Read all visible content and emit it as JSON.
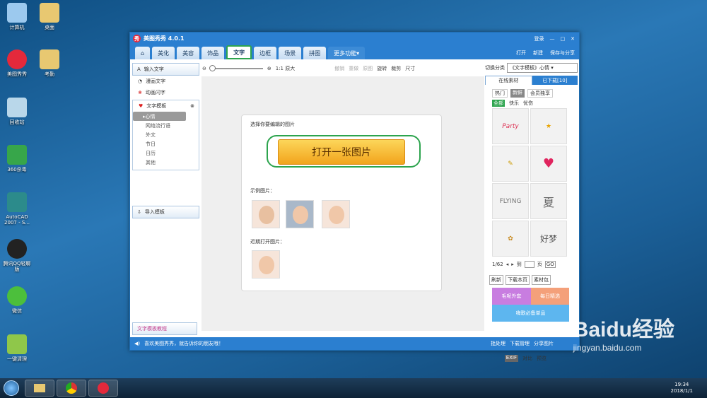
{
  "desktop_icons": [
    "计算机",
    "桌面",
    "美图秀秀",
    "考勤",
    "回收站",
    "360杀毒",
    "AutoCAD 2007 - S...",
    "腾讯QQ轻聊版",
    "微信",
    "一键清理"
  ],
  "window": {
    "title": "美图秀秀 4.0.1",
    "login": "登录"
  },
  "tabs": [
    "美化",
    "美容",
    "饰品",
    "文字",
    "边框",
    "场景",
    "拼图",
    "更多功能"
  ],
  "tab_actions": [
    "打开",
    "新建",
    "保存与分享"
  ],
  "left": {
    "input_text": "输入文字",
    "comic_text": "漫画文字",
    "animated_text": "动画闪字",
    "template_title": "文字模板",
    "subs": [
      "心情",
      "网络流行语",
      "外文",
      "节日",
      "日历",
      "其他"
    ],
    "import": "导入模板",
    "tutorial": "文字模板教程"
  },
  "toolbar": {
    "original": "1:1 原大",
    "undo": "撤销",
    "redo": "重做",
    "original_img": "原图",
    "rotate": "旋转",
    "crop": "裁剪",
    "size": "尺寸"
  },
  "card": {
    "choose": "选择你要编辑的图片",
    "open": "打开一张图片",
    "examples": "示例图片：",
    "recent": "近期打开图片："
  },
  "right": {
    "switch_label": "切换分类",
    "switch_value": "《文字模板》心情",
    "tab_online": "在线素材",
    "tab_downloaded": "已下载[10]",
    "filters": [
      "热门",
      "新鲜",
      "会员独享"
    ],
    "cats": [
      "全部",
      "快乐",
      "忧伤"
    ],
    "page": "1/62",
    "goto": "到",
    "page_unit": "页",
    "go": "GO",
    "actions": [
      "刷新",
      "下载本页",
      "素材包"
    ],
    "banners": [
      "毛呢外套",
      "每日精选",
      "嗨歌必备单品"
    ]
  },
  "canvas_bottom": {
    "exif": "EXIF",
    "compare": "对比",
    "preview": "预览"
  },
  "status": {
    "msg": "喜欢美图秀秀，就告诉你的朋友哦！",
    "batch": "批处理",
    "download": "下载管理",
    "share": "分享图片"
  },
  "clock": {
    "time": "19:34",
    "date": "2018/1/1"
  },
  "watermark": {
    "brand": "Baidu经验",
    "url": "jingyan.baidu.com"
  }
}
